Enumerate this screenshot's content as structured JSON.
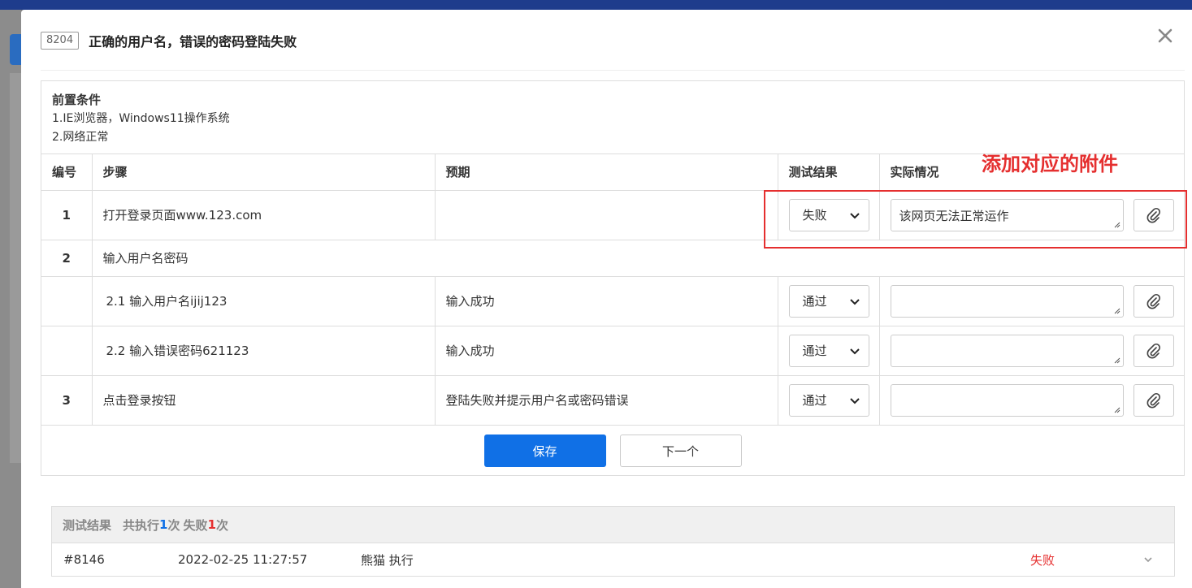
{
  "case": {
    "id": "8204",
    "title": "正确的用户名，错误的密码登陆失败"
  },
  "precondition": {
    "title": "前置条件",
    "lines": [
      "1.IE浏览器，Windows11操作系统",
      "2.网络正常"
    ]
  },
  "table": {
    "headers": {
      "num": "编号",
      "step": "步骤",
      "expect": "预期",
      "result": "测试结果",
      "actual": "实际情况"
    },
    "rows": [
      {
        "num": "1",
        "step": "打开登录页面www.123.com",
        "expect": "",
        "result": "失败",
        "actual": "该网页无法正常运作"
      },
      {
        "num": "2",
        "step": "输入用户名密码"
      },
      {
        "num": "",
        "step": "2.1  输入用户名ijij123",
        "expect": "输入成功",
        "result": "通过",
        "actual": ""
      },
      {
        "num": "",
        "step": "2.2  输入错误密码621123",
        "expect": "输入成功",
        "result": "通过",
        "actual": ""
      },
      {
        "num": "3",
        "step": "点击登录按钮",
        "expect": "登陆失败并提示用户名或密码错误",
        "result": "通过",
        "actual": ""
      }
    ]
  },
  "buttons": {
    "save": "保存",
    "next": "下一个"
  },
  "annotation": {
    "text": "添加对应的附件",
    "color": "#e52f2f"
  },
  "results": {
    "label": "测试结果",
    "exec_prefix": "共执行",
    "exec_count": "1",
    "exec_suffix": "次",
    "fail_prefix": "失败",
    "fail_count": "1",
    "fail_suffix": "次",
    "records": [
      {
        "id": "#8146",
        "date": "2022-02-25 11:27:57",
        "user": "熊猫 执行",
        "status": "失败"
      }
    ]
  },
  "colors": {
    "primary": "#1070e6",
    "danger": "#e52f2f"
  }
}
